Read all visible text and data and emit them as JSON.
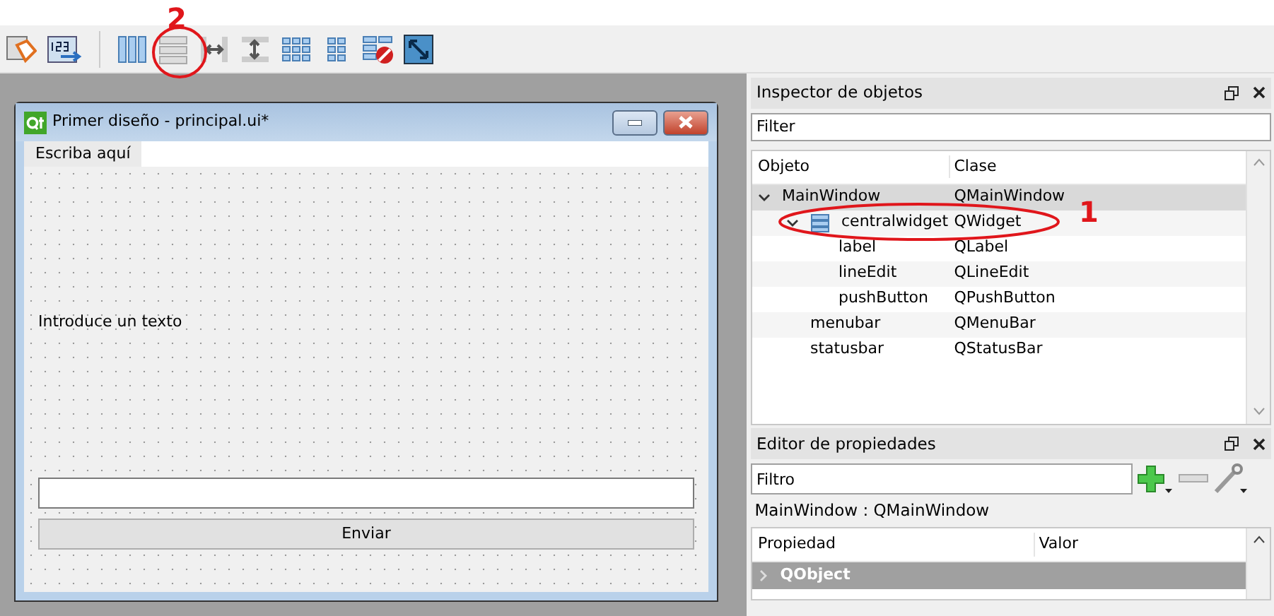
{
  "form_window": {
    "title": "Primer diseño - principal.ui*",
    "menu_placeholder": "Escriba aquí",
    "label": "Introduce un texto",
    "button": "Enviar"
  },
  "object_inspector": {
    "title": "Inspector de objetos",
    "filter": {
      "placeholder": "Filter"
    },
    "columns": [
      "Objeto",
      "Clase"
    ],
    "tree": [
      {
        "name": "MainWindow",
        "class": "QMainWindow",
        "layout_icon": false,
        "selected": true,
        "expanded": true,
        "children": [
          {
            "name": "centralwidget",
            "class": "QWidget",
            "layout_icon": true,
            "selected": false,
            "expanded": true,
            "children": [
              {
                "name": "label",
                "class": "QLabel",
                "layout_icon": false,
                "selected": false
              },
              {
                "name": "lineEdit",
                "class": "QLineEdit",
                "layout_icon": false,
                "selected": false
              },
              {
                "name": "pushButton",
                "class": "QPushButton",
                "layout_icon": false,
                "selected": false
              }
            ]
          },
          {
            "name": "menubar",
            "class": "QMenuBar",
            "layout_icon": false,
            "selected": false
          },
          {
            "name": "statusbar",
            "class": "QStatusBar",
            "layout_icon": false,
            "selected": false
          }
        ]
      }
    ]
  },
  "property_editor": {
    "title": "Editor de propiedades",
    "filter": {
      "placeholder": "Filtro"
    },
    "object_label": "MainWindow : QMainWindow",
    "columns": [
      "Propiedad",
      "Valor"
    ],
    "groups": [
      {
        "name": "QObject",
        "expanded": false
      }
    ]
  },
  "annotations": [
    {
      "text": "2"
    },
    {
      "text": "1"
    }
  ]
}
